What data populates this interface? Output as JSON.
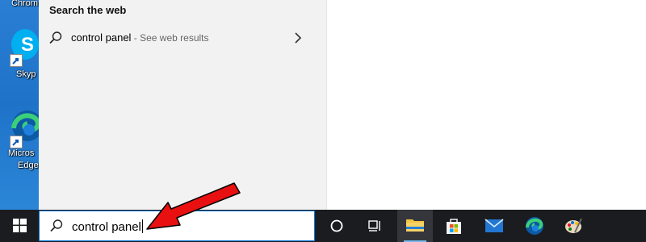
{
  "desktop": {
    "icons": [
      {
        "label": "Chrom"
      },
      {
        "label": "Skyp"
      },
      {
        "label_line1": "Micros",
        "label_line2": "Edge"
      }
    ]
  },
  "start_menu": {
    "section_title": "Search the web",
    "result": {
      "query": "control panel",
      "suffix": " - See web results"
    }
  },
  "taskbar": {
    "search_value": "control panel",
    "apps": [
      "start-button",
      "cortana",
      "task-view",
      "file-explorer",
      "microsoft-store",
      "mail",
      "edge",
      "paint"
    ]
  },
  "colors": {
    "accent": "#0078d7",
    "taskbar": "#1b1c20",
    "arrow": "#e81010",
    "menu": "#f2f2f2"
  }
}
